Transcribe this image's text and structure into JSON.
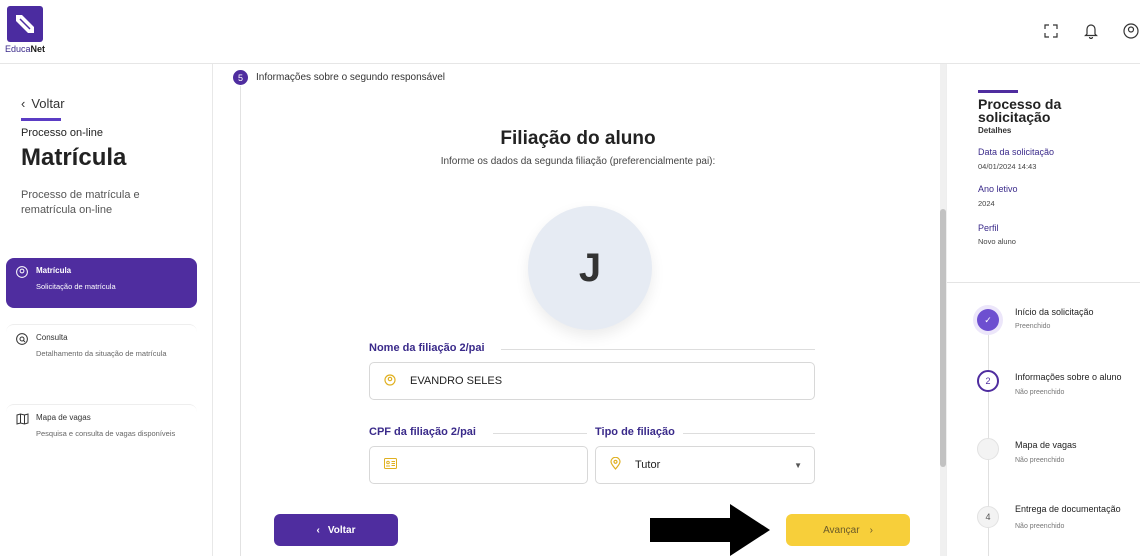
{
  "header": {
    "logo_name": "EducaNet",
    "logo_prefix": "Educa",
    "logo_suffix": "Net",
    "icons": [
      "fullscreen-icon",
      "bell-icon",
      "user-icon"
    ]
  },
  "sidebar": {
    "back_label": "Voltar",
    "process_label": "Processo on-line",
    "process_title": "Matrícula",
    "process_desc": "Processo de matrícula e rematrícula on-line",
    "items": [
      {
        "title": "Matrícula",
        "sub": "Solicitação de matrícula",
        "icon": "user-icon",
        "active": true
      },
      {
        "title": "Consulta",
        "sub": "Detalhamento da situação de matrícula",
        "icon": "search-icon",
        "active": false
      },
      {
        "title": "Mapa de vagas",
        "sub": "Pesquisa e consulta de vagas disponíveis",
        "icon": "map-icon",
        "active": false
      }
    ]
  },
  "main": {
    "step_number": "5",
    "step_label": "Informações sobre o segundo responsável",
    "title": "Filiação do aluno",
    "subtitle": "Informe os dados da segunda filiação (preferencialmente pai):",
    "avatar_initial": "J",
    "name_label": "Nome da filiação 2/pai",
    "name_value": "EVANDRO SELES",
    "cpf_label": "CPF da filiação 2/pai",
    "cpf_value": "",
    "type_label": "Tipo de filiação",
    "type_value": "Tutor",
    "back_button": "Voltar",
    "next_button": "Avançar"
  },
  "details": {
    "title": "Processo da solicitação",
    "subtitle": "Detalhes",
    "fields": [
      {
        "key": "Data da solicitação",
        "value": "04/01/2024 14:43"
      },
      {
        "key": "Ano letivo",
        "value": "2024"
      },
      {
        "key": "Perfil",
        "value": "Novo aluno"
      }
    ],
    "timeline": [
      {
        "marker": "✓",
        "title": "Início da solicitação",
        "status": "Preenchido",
        "state": "done"
      },
      {
        "marker": "2",
        "title": "Informações sobre o aluno",
        "status": "Não preenchido",
        "state": "current"
      },
      {
        "marker": "",
        "title": "Mapa de vagas",
        "status": "Não preenchido",
        "state": "todo"
      },
      {
        "marker": "4",
        "title": "Entrega de documentação",
        "status": "Não preenchido",
        "state": "todo"
      }
    ]
  },
  "colors": {
    "primary": "#4f2d9f",
    "accent": "#f7cf3a"
  }
}
